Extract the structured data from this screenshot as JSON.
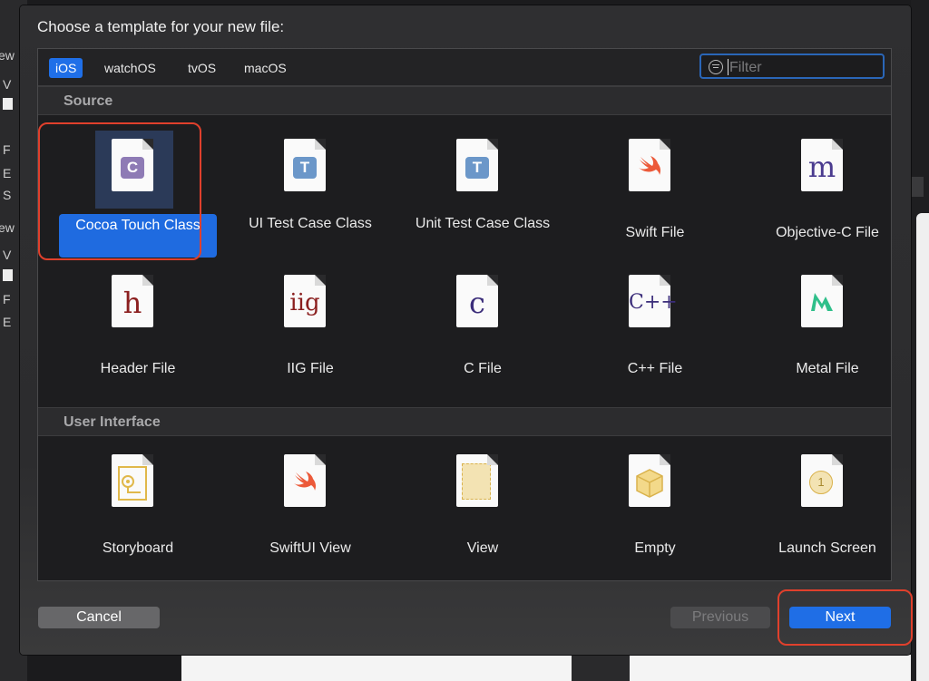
{
  "background": {
    "left_fragments": [
      "ew",
      "V",
      "F",
      "E",
      "S",
      "ew",
      "V",
      "F",
      "E"
    ]
  },
  "dialog": {
    "title": "Choose a template for your new file:",
    "platforms": [
      "iOS",
      "watchOS",
      "tvOS",
      "macOS"
    ],
    "active_platform": "iOS",
    "filter": {
      "placeholder": "Filter",
      "value": ""
    },
    "sections": [
      {
        "title": "Source",
        "templates": [
          {
            "label": "Cocoa Touch Class",
            "icon": "cocoa-touch-class-icon",
            "glyph": "C",
            "selected": true
          },
          {
            "label": "UI Test Case Class",
            "icon": "ui-test-case-icon",
            "glyph": "T"
          },
          {
            "label": "Unit Test Case Class",
            "icon": "unit-test-case-icon",
            "glyph": "T"
          },
          {
            "label": "Swift File",
            "icon": "swift-icon",
            "glyph": ""
          },
          {
            "label": "Objective-C File",
            "icon": "objective-c-icon",
            "glyph": "m"
          },
          {
            "label": "Header File",
            "icon": "header-file-icon",
            "glyph": "h"
          },
          {
            "label": "IIG File",
            "icon": "iig-file-icon",
            "glyph": "iig"
          },
          {
            "label": "C File",
            "icon": "c-file-icon",
            "glyph": "c"
          },
          {
            "label": "C++ File",
            "icon": "cpp-file-icon",
            "glyph": "C++"
          },
          {
            "label": "Metal File",
            "icon": "metal-file-icon",
            "glyph": ""
          }
        ]
      },
      {
        "title": "User Interface",
        "templates": [
          {
            "label": "Storyboard",
            "icon": "storyboard-icon"
          },
          {
            "label": "SwiftUI View",
            "icon": "swiftui-view-icon"
          },
          {
            "label": "View",
            "icon": "view-icon"
          },
          {
            "label": "Empty",
            "icon": "empty-icon"
          },
          {
            "label": "Launch Screen",
            "icon": "launch-screen-icon",
            "glyph": "1"
          }
        ]
      }
    ],
    "buttons": {
      "cancel": "Cancel",
      "previous": "Previous",
      "next": "Next"
    }
  },
  "colors": {
    "accent": "#1f6fe8",
    "highlight_ring": "#e0402c",
    "sheet_bg": "#2c2c2e"
  }
}
